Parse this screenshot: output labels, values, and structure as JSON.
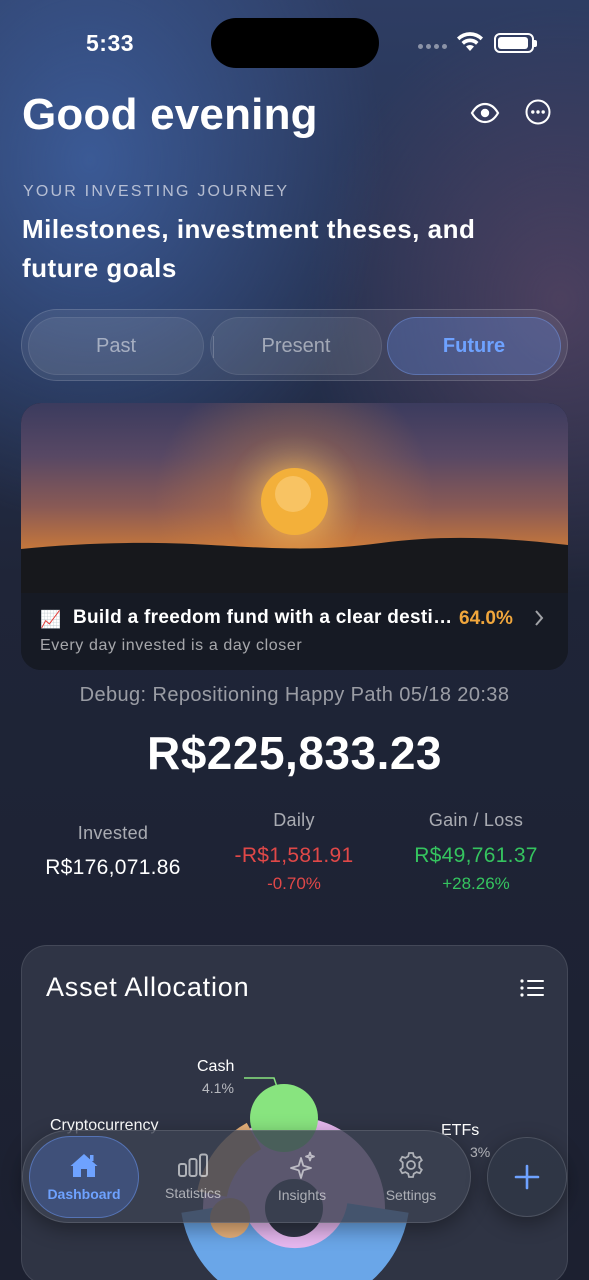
{
  "status_bar": {
    "time": "5:33"
  },
  "header": {
    "greeting": "Good evening",
    "icons": [
      "eye-icon",
      "more-icon"
    ]
  },
  "journey": {
    "kicker": "YOUR INVESTING JOURNEY",
    "title": "Milestones, investment theses, and future goals",
    "segments": [
      "Past",
      "Present",
      "Future"
    ],
    "selected_segment": "Future"
  },
  "goal_card": {
    "emoji": "📈",
    "title": "Build a freedom fund with a clear destination",
    "progress": "64.0%",
    "subtitle": "Every day invested is a day closer",
    "accent": "#f0a63c"
  },
  "summary": {
    "debug": "Debug: Repositioning Happy Path 05/18 20:38",
    "total": "R$225,833.23",
    "invested_label": "Invested",
    "invested_value": "R$176,071.86",
    "daily_label": "Daily",
    "daily_value": "-R$1,581.91",
    "daily_pct": "-0.70%",
    "gain_label": "Gain / Loss",
    "gain_value": "R$49,761.37",
    "gain_pct": "+28.26%",
    "negative_color": "#e04848",
    "positive_color": "#35c45f"
  },
  "allocation": {
    "title": "Asset Allocation",
    "labels": {
      "cash": "Cash",
      "cash_pct": "4.1%",
      "crypto": "Cryptocurrency",
      "etfs": "ETFs",
      "etfs_pct": "3%"
    }
  },
  "tabbar": {
    "tabs": [
      {
        "label": "Dashboard",
        "icon": "house-icon",
        "active": true
      },
      {
        "label": "Statistics",
        "icon": "bar-chart-icon",
        "active": false
      },
      {
        "label": "Insights",
        "icon": "sparkles-icon",
        "active": false
      },
      {
        "label": "Settings",
        "icon": "gear-icon",
        "active": false
      }
    ],
    "add_icon": "plus-icon",
    "accent": "#6ea2ff"
  }
}
